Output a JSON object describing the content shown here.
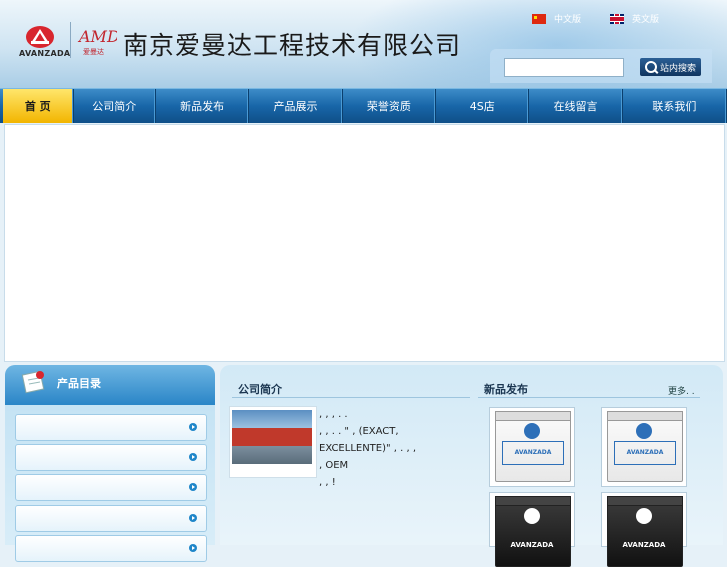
{
  "header": {
    "brand": "AVANZADA",
    "company_name": "南京爱曼达工程技术有限公司",
    "lang_cn": "中文版",
    "lang_en": "英文版",
    "search": {
      "placeholder": "",
      "button_label": "站内搜索"
    }
  },
  "nav": {
    "items": [
      "首 页",
      "公司简介",
      "新品发布",
      "产品展示",
      "荣誉资质",
      "4S店",
      "在线留言",
      "联系我们"
    ]
  },
  "left": {
    "title": "产品目录",
    "items": [
      "",
      "",
      "",
      "",
      ""
    ]
  },
  "main": {
    "about_title": "公司简介",
    "about_text": [
      ",          ,   ,  .     .",
      ",          ,     .      .  \" , (EXACT,",
      "EXCELLENTE)\"     ,      .    ,      ,",
      "     ,           OEM",
      "          ,        ,      !"
    ],
    "news_title": "新品发布",
    "more_label": "更多. .",
    "products": [
      {
        "name": "AVANZADA",
        "style": "white"
      },
      {
        "name": "AVANZADA",
        "style": "white"
      },
      {
        "name": "AVANZADA",
        "style": "dark"
      },
      {
        "name": "AVANZADA",
        "style": "dark"
      }
    ]
  },
  "colors": {
    "nav_bg": "#1866a8",
    "nav_active": "#f2b500",
    "panel_head": "#2a85c7",
    "page_bg": "#e6f1f8"
  }
}
